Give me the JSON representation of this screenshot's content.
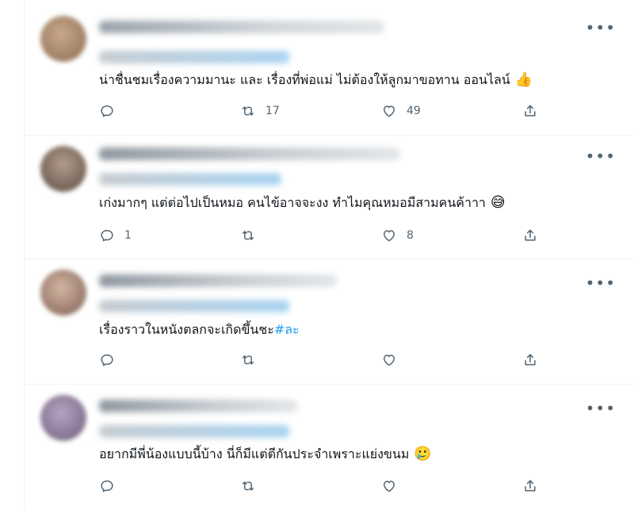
{
  "tweets": [
    {
      "text": "น่าชื่นชมเรื่องความมานะ และ เรื่องที่พ่อแม่ ไม่ต้องให้ลูกมาขอทาน ออนไลน์",
      "emoji": "👍",
      "reply_count": "",
      "retweet_count": "17",
      "like_count": "49"
    },
    {
      "text": "เก่งมากๆ แต่ต่อไปเป็นหมอ คนไข้อาจจะงง ทำไมคุณหมอมีสามคนค้าาา",
      "emoji": "😅",
      "reply_count": "1",
      "retweet_count": "",
      "like_count": "8"
    },
    {
      "text": "เรื่องราวในหนังตลกจะเกิดขึ้นชะ",
      "hashtag": "#ละ",
      "emoji": "",
      "reply_count": "",
      "retweet_count": "",
      "like_count": ""
    },
    {
      "text": "อยากมีพี่น้องแบบนี้บ้าง นี่ก็มีแต่ตีกันประจำเพราะแย่งขนม",
      "emoji": "🥲",
      "reply_count": "",
      "retweet_count": "",
      "like_count": ""
    }
  ],
  "icons": {
    "more": "more-options-icon",
    "reply": "reply-icon",
    "retweet": "retweet-icon",
    "like": "like-icon",
    "share": "share-icon"
  },
  "colors": {
    "icon": "#536471",
    "hashtag": "#1d9bf0",
    "divider": "#eff3f4"
  }
}
